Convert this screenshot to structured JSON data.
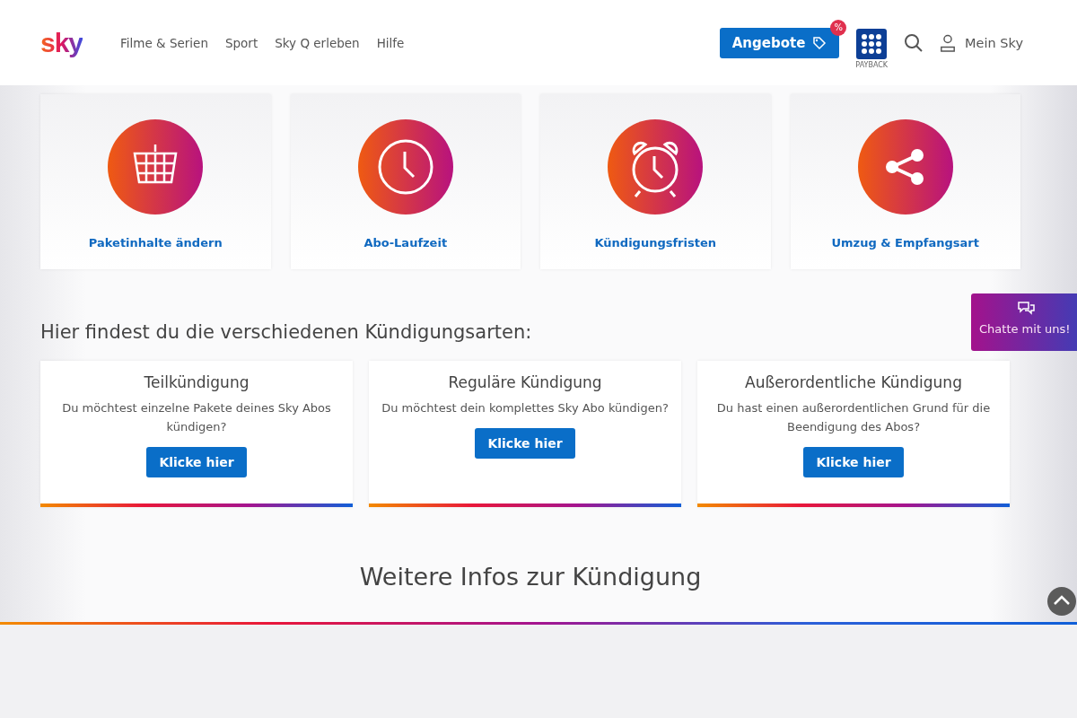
{
  "header": {
    "logo": "sky",
    "nav": [
      "Filme & Serien",
      "Sport",
      "Sky Q erleben",
      "Hilfe"
    ],
    "offers_button": "Angebote",
    "offers_badge": "%",
    "payback_label": "PAYBACK",
    "account_link": "Mein Sky"
  },
  "topics": [
    {
      "label": "Paketinhalte ändern",
      "kind": "basket"
    },
    {
      "label": "Abo-Laufzeit",
      "kind": "clock"
    },
    {
      "label": "Kündigungsfristen",
      "kind": "alarm"
    },
    {
      "label": "Umzug & Empfangsart",
      "kind": "share"
    }
  ],
  "section_heading": "Hier findest du die verschiedenen Kündigungsarten:",
  "cancellation_types": [
    {
      "title": "Teilkündigung",
      "description": "Du möchtest einzelne Pakete deines Sky Abos kündigen?",
      "button": "Klicke hier"
    },
    {
      "title": "Reguläre Kündigung",
      "description": "Du möchtest dein komplettes Sky Abo kündigen?",
      "button": "Klicke hier"
    },
    {
      "title": "Außerordentliche Kündigung",
      "description": "Du hast einen außerordentlichen Grund für die Beendigung des Abos?",
      "button": "Klicke hier"
    }
  ],
  "more_heading": "Weitere Infos zur Kündigung",
  "chat_button": "Chatte mit uns!"
}
